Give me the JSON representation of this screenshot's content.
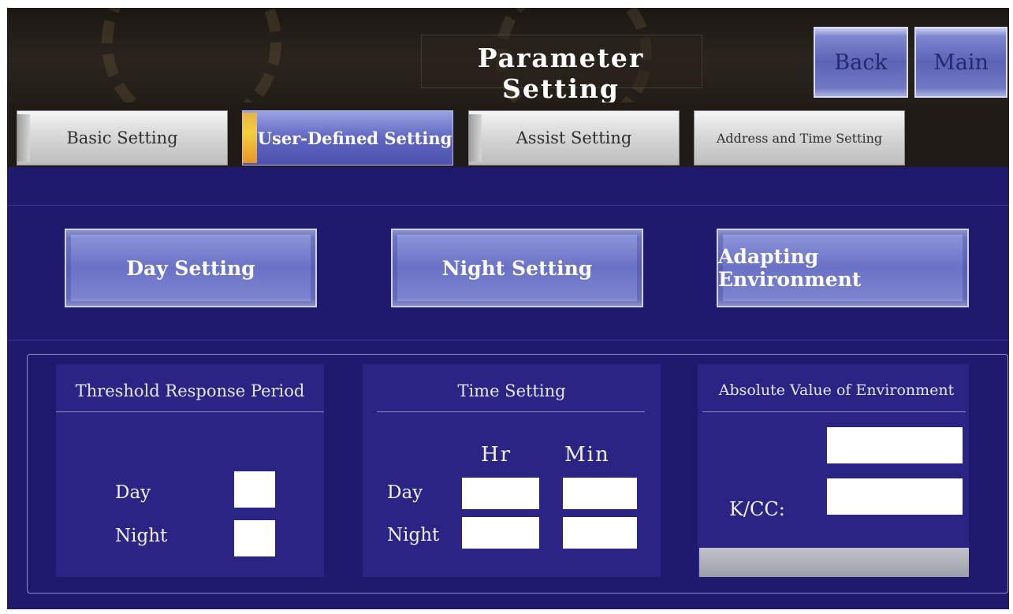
{
  "header": {
    "title": "Parameter Setting",
    "back_label": "Back",
    "main_label": "Main"
  },
  "tabs": [
    {
      "label": "Basic Setting",
      "active": false
    },
    {
      "label": "User-Defined Setting",
      "active": true
    },
    {
      "label": "Assist Setting",
      "active": false
    },
    {
      "label": "Address and Time Setting",
      "active": false
    }
  ],
  "modes": {
    "day": "Day Setting",
    "night": "Night Setting",
    "adapting": "Adapting Environment"
  },
  "threshold_panel": {
    "title": "Threshold Response Period",
    "day_label": "Day",
    "night_label": "Night"
  },
  "time_panel": {
    "title": "Time Setting",
    "hr_label": "Hr",
    "min_label": "Min",
    "day_label": "Day",
    "night_label": "Night"
  },
  "environment_panel": {
    "title": "Absolute Value of Environment",
    "kcc_label": "K/CC:"
  },
  "colors": {
    "background": "#1f1a6e",
    "header": "#1b1713",
    "button_blue": "#6a72c6",
    "active_marker": "#f3d03b"
  }
}
